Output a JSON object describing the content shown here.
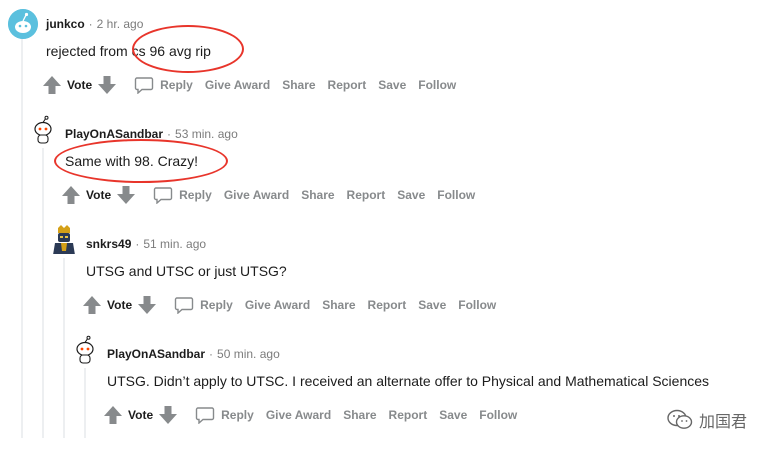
{
  "comments": [
    {
      "author": "junkco",
      "time": "2 hr. ago",
      "text": "rejected from cs 96 avg rip",
      "avatar_icon": "snoo-avatar-icon",
      "avatar_color": "#5bc0de"
    },
    {
      "author": "PlayOnASandbar",
      "time": "53 min. ago",
      "text": "Same with 98. Crazy!",
      "avatar_icon": "snoo-avatar-icon",
      "avatar_color": "#ffffff"
    },
    {
      "author": "snkrs49",
      "time": "51 min. ago",
      "text": "UTSG and UTSC or just UTSG?",
      "avatar_icon": "gold-character-avatar-icon",
      "avatar_color": "#2b3a55"
    },
    {
      "author": "PlayOnASandbar",
      "time": "50 min. ago",
      "text": "UTSG. Didn’t apply to UTSC. I received an alternate offer to Physical and Mathematical Sciences",
      "avatar_icon": "snoo-avatar-icon",
      "avatar_color": "#ffffff"
    }
  ],
  "actions": {
    "vote": "Vote",
    "reply": "Reply",
    "give_award": "Give Award",
    "share": "Share",
    "report": "Report",
    "save": "Save",
    "follow": "Follow"
  },
  "watermark": {
    "text": "加国君",
    "icon": "wechat-icon"
  },
  "colors": {
    "highlight_ring": "#e8352b",
    "meta_gray": "#7c7c7c",
    "action_gray": "#878a8c",
    "thread_line": "#edeff1"
  }
}
